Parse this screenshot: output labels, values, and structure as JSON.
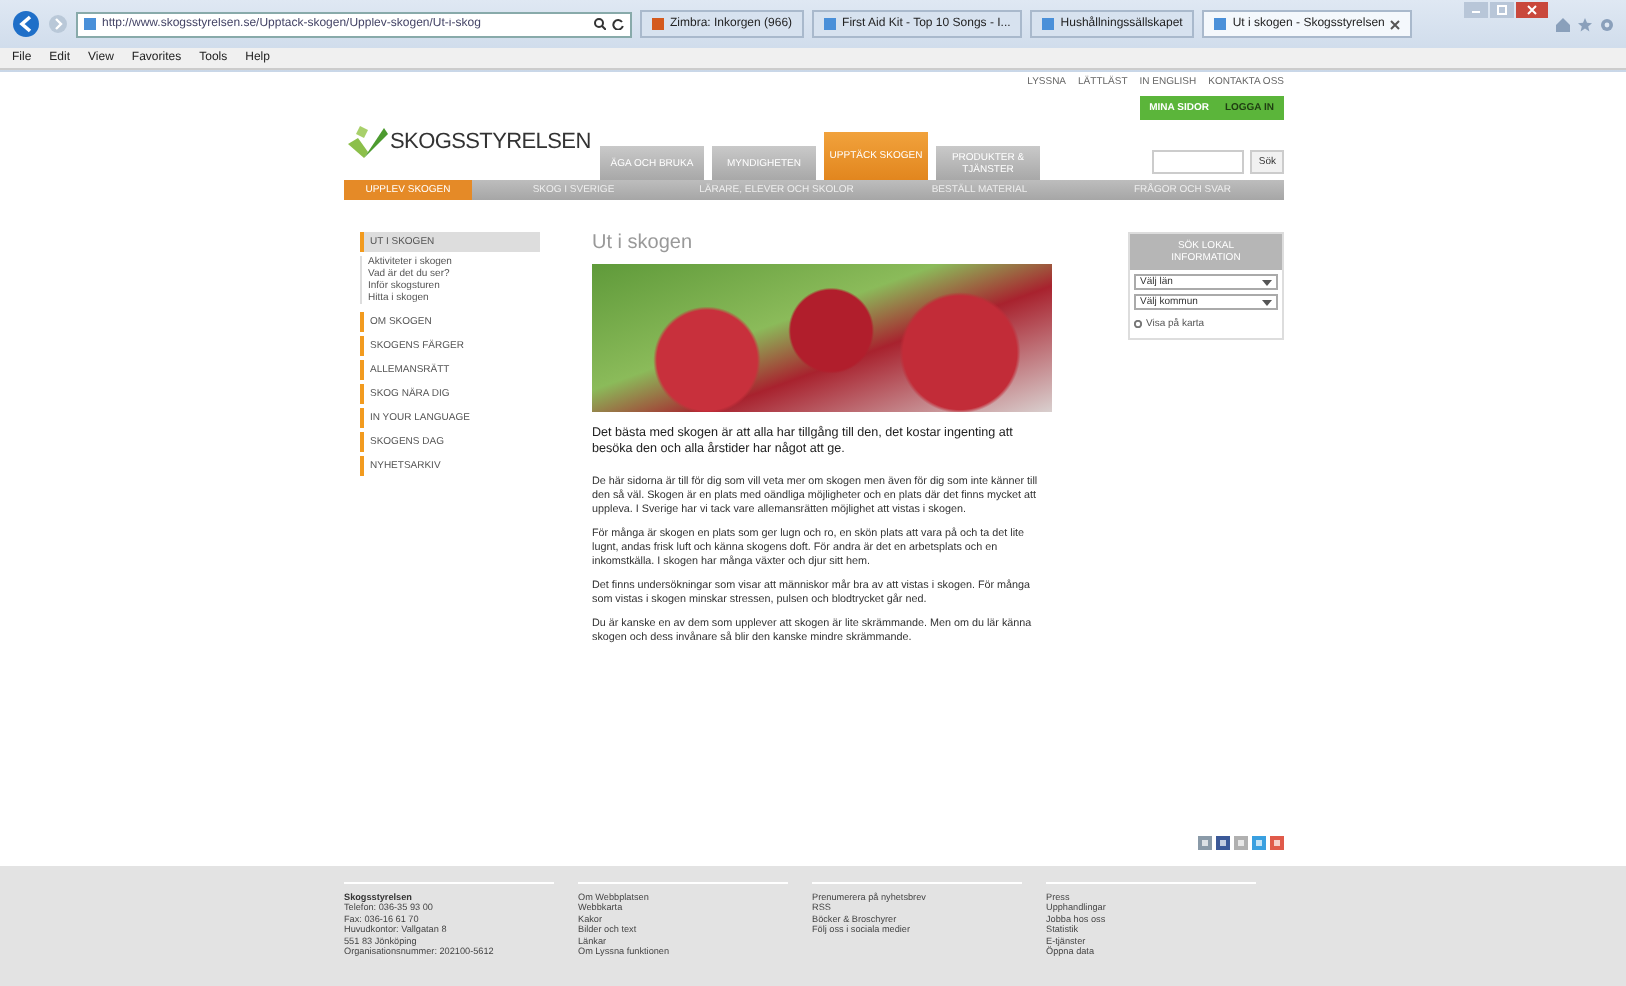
{
  "browser": {
    "url": "http://www.skogsstyrelsen.se/Upptack-skogen/Upplev-skogen/Ut-i-skog",
    "tabs": [
      {
        "label": "Zimbra: Inkorgen (966)",
        "selected": false
      },
      {
        "label": "First Aid Kit - Top 10 Songs - I...",
        "selected": false
      },
      {
        "label": "Hushållningssällskapet",
        "selected": false
      },
      {
        "label": "Ut i skogen - Skogsstyrelsen",
        "selected": true
      }
    ],
    "menu": [
      "File",
      "Edit",
      "View",
      "Favorites",
      "Tools",
      "Help"
    ]
  },
  "header": {
    "logo": "SKOGSSTYRELSEN",
    "top_links": [
      "LYSSNA",
      "LÄTTLÄST",
      "IN ENGLISH",
      "KONTAKTA OSS"
    ],
    "account_buttons": [
      "MINA SIDOR",
      "LOGGA IN"
    ],
    "main_tabs": [
      {
        "label": "ÄGA OCH BRUKA",
        "selected": false
      },
      {
        "label": "MYNDIGHETEN",
        "selected": false
      },
      {
        "label": "UPPTÄCK SKOGEN",
        "selected": true
      },
      {
        "label": "PRODUKTER & TJÄNSTER",
        "selected": false
      }
    ],
    "search": {
      "button": "Sök"
    },
    "sub_tabs": [
      {
        "label": "UPPLEV SKOGEN",
        "selected": true
      },
      {
        "label": "SKOG I SVERIGE",
        "selected": false
      },
      {
        "label": "LÄRARE, ELEVER OCH SKOLOR",
        "selected": false
      },
      {
        "label": "BESTÄLL MATERIAL",
        "selected": false
      },
      {
        "label": "FRÅGOR OCH SVAR",
        "selected": false
      }
    ]
  },
  "sidebar": {
    "items": [
      {
        "label": "UT I SKOGEN",
        "selected": true,
        "children": [
          {
            "label": "Aktiviteter i skogen"
          },
          {
            "label": "Vad är det du ser?"
          },
          {
            "label": "Inför skogsturen"
          },
          {
            "label": "Hitta i skogen"
          }
        ]
      },
      {
        "label": "OM SKOGEN",
        "selected": false
      },
      {
        "label": "SKOGENS FÄRGER",
        "selected": false
      },
      {
        "label": "ALLEMANSRÄTT",
        "selected": false
      },
      {
        "label": "SKOG NÄRA DIG",
        "selected": false
      },
      {
        "label": "IN YOUR LANGUAGE",
        "selected": false
      },
      {
        "label": "SKOGENS DAG",
        "selected": false
      },
      {
        "label": "NYHETSARKIV",
        "selected": false
      }
    ]
  },
  "article": {
    "title": "Ut i skogen",
    "intro": "Det bästa med skogen är att alla har tillgång till den, det kostar ingenting att besöka den och alla årstider har något att ge.",
    "paragraphs": [
      "De här sidorna är till för dig som vill veta mer om skogen men även för dig som inte känner till den så väl. Skogen är en plats med oändliga möjligheter och en plats där det finns mycket att uppleva. I Sverige har vi tack vare allemansrätten möjlighet att vistas i skogen.",
      "För många är skogen en plats som ger lugn och ro, en skön plats att vara på och ta det lite lugnt, andas frisk luft och känna skogens doft. För andra är det en arbetsplats och en inkomstkälla. I skogen har många växter och djur sitt hem.",
      "Det finns undersökningar som visar att människor mår bra av att vistas i skogen. För många som vistas i skogen minskar stressen, pulsen och blodtrycket går ned.",
      "Du är kanske en av dem som upplever att skogen är lite skrämmande. Men om du lär känna skogen och dess invånare så blir den kanske mindre skrämmande."
    ]
  },
  "info_box": {
    "title": "SÖK LOKAL INFORMATION",
    "selects": [
      "Välj län",
      "Välj kommun"
    ],
    "link": "Visa på karta"
  },
  "footer": {
    "columns": [
      {
        "title": "Skogsstyrelsen",
        "lines": [
          "Telefon: 036-35 93 00",
          "Fax: 036-16 61 70",
          "Huvudkontor: Vallgatan 8",
          "551 83 Jönköping",
          "Organisationsnummer: 202100-5612"
        ]
      },
      {
        "lines": [
          "Om Webbplatsen",
          "Webbkarta",
          "Kakor",
          "Bilder och text",
          "Länkar",
          "Om Lyssna funktionen"
        ]
      },
      {
        "lines": [
          "Prenumerera på nyhetsbrev",
          "RSS",
          "Böcker & Broschyrer",
          "Följ oss i sociala medier"
        ]
      },
      {
        "lines": [
          "Press",
          "Upphandlingar",
          "Jobba hos oss",
          "Statistik",
          "E-tjänster",
          "Öppna data"
        ]
      }
    ]
  }
}
